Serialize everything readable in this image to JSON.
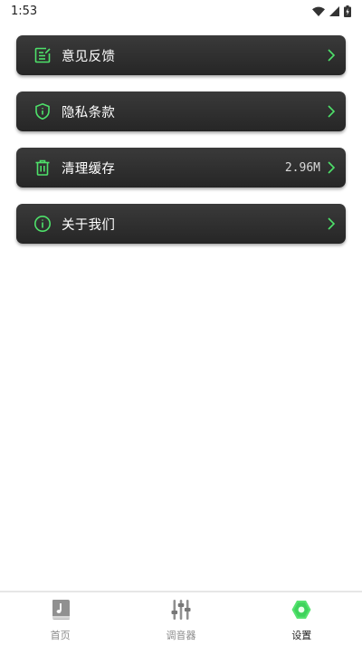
{
  "status_bar": {
    "time": "1:53"
  },
  "colors": {
    "accent": "#4ee26a",
    "card_bg": "#2e2e2e",
    "chevron": "#4ee26a"
  },
  "menu": {
    "items": [
      {
        "label": "意见反馈",
        "icon": "feedback-edit-icon",
        "value": ""
      },
      {
        "label": "隐私条款",
        "icon": "shield-info-icon",
        "value": ""
      },
      {
        "label": "清理缓存",
        "icon": "trash-icon",
        "value": "2.96M"
      },
      {
        "label": "关于我们",
        "icon": "info-circle-icon",
        "value": ""
      }
    ]
  },
  "tab_bar": {
    "tabs": [
      {
        "label": "首页",
        "icon": "home-book-icon",
        "active": false
      },
      {
        "label": "调音器",
        "icon": "tuner-sliders-icon",
        "active": false
      },
      {
        "label": "设置",
        "icon": "settings-hexagon-icon",
        "active": true
      }
    ]
  }
}
